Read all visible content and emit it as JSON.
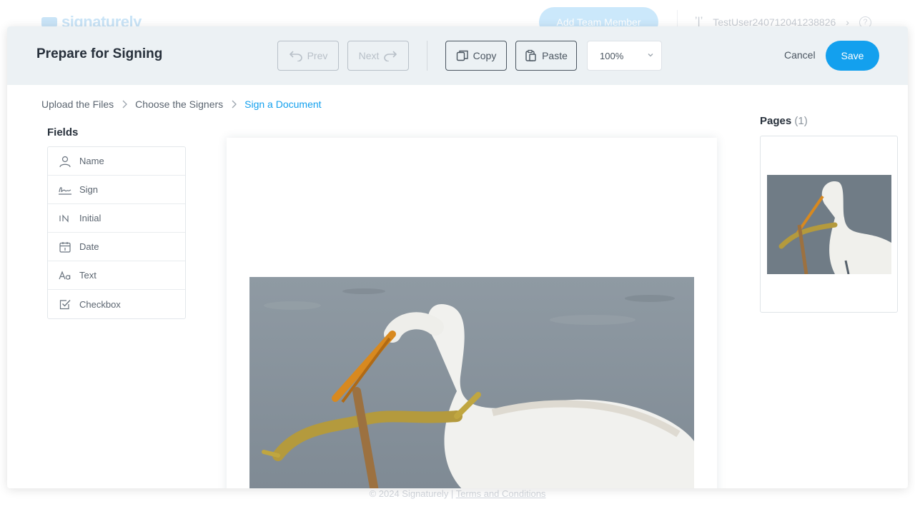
{
  "app": {
    "logo_text": "signaturely",
    "add_team_label": "Add Team Member",
    "username": "TestUser240712041238826"
  },
  "footer": {
    "copyright": "© 2024 Signaturely | ",
    "terms_label": "Terms and Conditions"
  },
  "modal": {
    "title": "Prepare for Signing",
    "toolbar": {
      "prev_label": "Prev",
      "next_label": "Next",
      "copy_label": "Copy",
      "paste_label": "Paste",
      "zoom_value": "100%"
    },
    "cancel_label": "Cancel",
    "save_label": "Save"
  },
  "breadcrumb": {
    "items": [
      {
        "label": "Upload the Files",
        "active": false
      },
      {
        "label": "Choose the Signers",
        "active": false
      },
      {
        "label": "Sign a Document",
        "active": true
      }
    ]
  },
  "fields": {
    "title": "Fields",
    "items": [
      {
        "label": "Name",
        "icon": "user-icon"
      },
      {
        "label": "Sign",
        "icon": "signature-icon"
      },
      {
        "label": "Initial",
        "icon": "initials-icon"
      },
      {
        "label": "Date",
        "icon": "calendar-icon"
      },
      {
        "label": "Text",
        "icon": "text-icon"
      },
      {
        "label": "Checkbox",
        "icon": "checkbox-icon"
      }
    ]
  },
  "pages": {
    "title": "Pages",
    "count": "(1)"
  },
  "colors": {
    "accent": "#13a0ee",
    "header_bg": "#ecf1f4"
  }
}
